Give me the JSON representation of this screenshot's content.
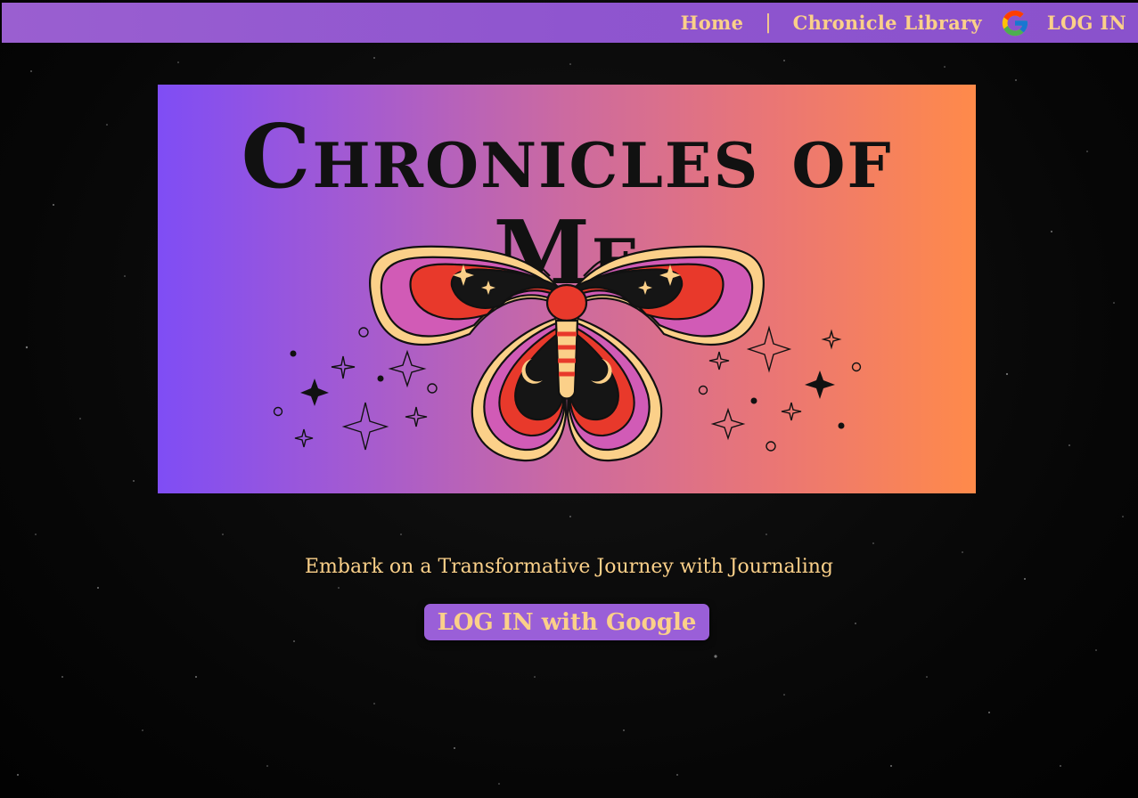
{
  "nav": {
    "home_label": "Home",
    "separator": "|",
    "library_label": "Chronicle Library",
    "google_icon": "google-icon",
    "login_label": "LOG IN"
  },
  "banner": {
    "title": "Chronicles of Me",
    "illustration": "moth-icon"
  },
  "main": {
    "tagline": "Embark on a Transformative Journey with Journaling",
    "login_button_label": "LOG IN with Google"
  },
  "colors": {
    "nav_bg": "#9a5fd0",
    "accent_text": "#fbd089",
    "banner_gradient_start": "#7f4df5",
    "banner_gradient_end": "#ff8a4a",
    "page_bg": "#050505"
  }
}
